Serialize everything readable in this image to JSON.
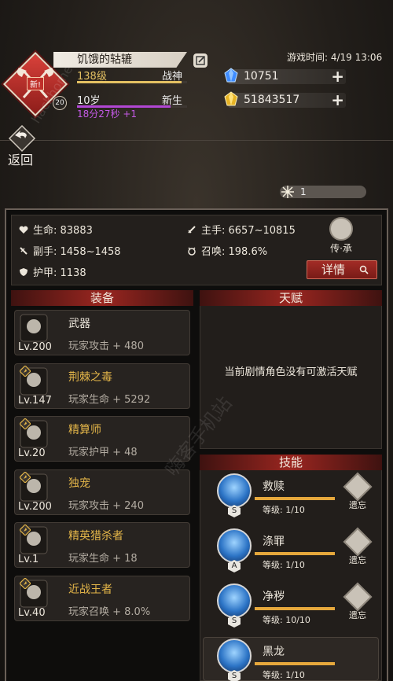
{
  "player": {
    "name": "饥饿的轱辘",
    "new_badge": "新!",
    "avatar_level": "20",
    "level_label": "138级",
    "title": "战神",
    "exp_fraction": 0.95,
    "age_label": "10岁",
    "stage": "新生",
    "age_fraction": 0.85,
    "timer": "18分27秒 +1"
  },
  "game_time": "游戏时间: 4/19 13:06",
  "currency": {
    "diamonds": "10751",
    "gold": "51843517",
    "plus": "+"
  },
  "back_label": "返回",
  "energy": "1",
  "stats": {
    "hp": "生命: 83883",
    "main_hand": "主手: 6657~10815",
    "off_hand": "副手: 1458~1458",
    "summon": "召唤: 198.6%",
    "armor": "护甲: 1138",
    "inherit_label": "传·承",
    "detail_label": "详情"
  },
  "equipment": {
    "header": "装备",
    "items": [
      {
        "name": "武器",
        "level": "Lv.200",
        "bonus": "玩家攻击 + 480",
        "color": "#ece6db"
      },
      {
        "name": "荆棘之毒",
        "level": "Lv.147",
        "bonus": "玩家生命 + 5292",
        "color": "#e4b649"
      },
      {
        "name": "精算师",
        "level": "Lv.20",
        "bonus": "玩家护甲 + 48",
        "color": "#e4b649"
      },
      {
        "name": "独宠",
        "level": "Lv.200",
        "bonus": "玩家攻击 + 240",
        "color": "#e4b649"
      },
      {
        "name": "精英猎杀者",
        "level": "Lv.1",
        "bonus": "玩家生命 + 18",
        "color": "#e4b649"
      },
      {
        "name": "近战王者",
        "level": "Lv.40",
        "bonus": "玩家召唤 + 8.0%",
        "color": "#e4b649"
      }
    ]
  },
  "talent": {
    "header": "天赋",
    "message": "当前剧情角色没有可激活天赋"
  },
  "skills": {
    "header": "技能",
    "forget_label": "遗忘",
    "items": [
      {
        "name": "救赎",
        "rank": "S",
        "level": "等级: 1/10"
      },
      {
        "name": "涤罪",
        "rank": "A",
        "level": "等级: 1/10"
      },
      {
        "name": "净秽",
        "rank": "S",
        "level": "等级: 10/10"
      },
      {
        "name": "黑龙",
        "rank": "S",
        "level": "等级: 1/10"
      }
    ]
  },
  "watermark": {
    "left": "hackhome",
    "right": "嗨客手机站"
  }
}
